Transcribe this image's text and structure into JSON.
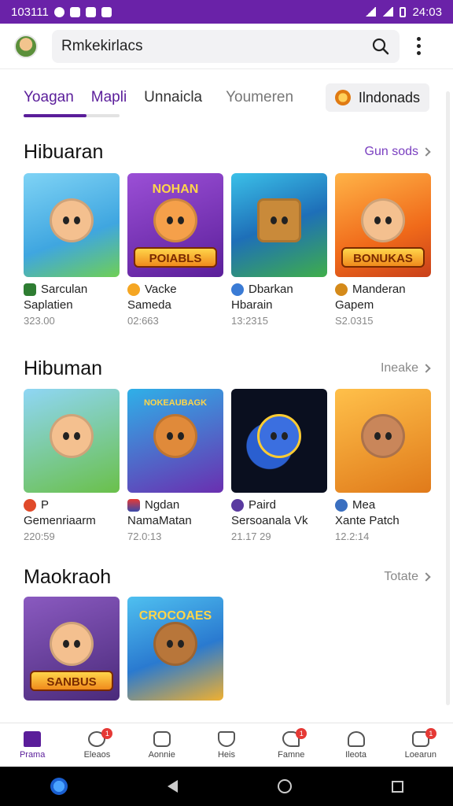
{
  "status_bar": {
    "left_text": "103111",
    "right_text": "24:03"
  },
  "header": {
    "search_value": "Rmkekirlacs"
  },
  "tabs": [
    {
      "label": "Yoagan"
    },
    {
      "label": "Mapli"
    },
    {
      "label": "Unnaicla"
    },
    {
      "label": "Youmeren"
    }
  ],
  "coin_button": {
    "label": "Ilndonads"
  },
  "sections": [
    {
      "title": "Hibuaran",
      "see_more": "Gun sods",
      "items": [
        {
          "line1": "Sarculan",
          "line2": "Saplatien",
          "value": "323.00",
          "color": "#f5a623",
          "banner": ""
        },
        {
          "line1": "Vacke",
          "line2": "Sameda",
          "value": "02:663",
          "color": "#7b2fbf",
          "banner": "POIABLS",
          "top_text": "NOHAN"
        },
        {
          "line1": "Dbarkan",
          "line2": "Hbarain",
          "value": "13:2315",
          "color": "#1e88b8",
          "banner": ""
        },
        {
          "line1": "Manderan",
          "line2": "Gapem",
          "value": "S2.0315",
          "color": "#f07a1a",
          "banner": "BONUKAS"
        }
      ]
    },
    {
      "title": "Hibuman",
      "see_more": "Ineake",
      "items": [
        {
          "line1": "P",
          "line2": "Gemenriaarm",
          "value": "220:59",
          "color": "#47b34a",
          "banner": ""
        },
        {
          "line1": "Ngdan",
          "line2": "NamaMatan",
          "value": "72.0:13",
          "color": "#2aa3e0",
          "banner": "",
          "top_text": "NOKEAUBAGK"
        },
        {
          "line1": "Paird",
          "line2": "Sersoanala Vk",
          "value": "21.17 29",
          "color": "#0e1a3a",
          "banner": ""
        },
        {
          "line1": "Mea",
          "line2": "Xante Patch",
          "value": "12.2:14",
          "color": "#f0a030",
          "banner": ""
        }
      ]
    },
    {
      "title": "Maokraoh",
      "see_more": "Totate",
      "items": [
        {
          "line1": "",
          "line2": "",
          "value": "",
          "color": "#6a3aa0",
          "banner": "SANBUS"
        },
        {
          "line1": "",
          "line2": "",
          "value": "",
          "color": "#2e9ae0",
          "banner": "",
          "top_text": "CROCOAES"
        }
      ]
    }
  ],
  "bottom_nav": [
    {
      "label": "Prama",
      "badge": ""
    },
    {
      "label": "Eleaos",
      "badge": "1"
    },
    {
      "label": "Aonnie",
      "badge": ""
    },
    {
      "label": "Heis",
      "badge": ""
    },
    {
      "label": "Famne",
      "badge": "1"
    },
    {
      "label": "Ileota",
      "badge": ""
    },
    {
      "label": "Loearun",
      "badge": "1"
    }
  ],
  "colors": {
    "accent": "#5a1d9a",
    "status_bar": "#6a22a8"
  }
}
